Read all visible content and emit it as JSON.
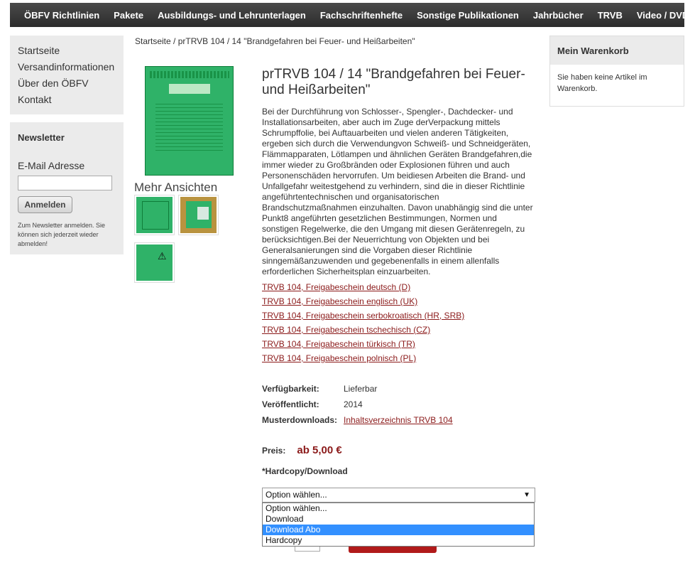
{
  "topnav": [
    "ÖBFV Richtlinien",
    "Pakete",
    "Ausbildungs- und Lehrunterlagen",
    "Fachschriftenhefte",
    "Sonstige Publikationen",
    "Jahrbücher",
    "TRVB",
    "Video / DVD"
  ],
  "sidebar": {
    "items": [
      "Startseite",
      "Versandinformationen",
      "Über den ÖBFV",
      "Kontakt"
    ]
  },
  "newsletter": {
    "title": "Newsletter",
    "email_label": "E-Mail Adresse",
    "button": "Anmelden",
    "note": "Zum Newsletter anmelden. Sie können sich jederzeit wieder abmelden!"
  },
  "breadcrumb": "Startseite / prTRVB 104 / 14 \"Brandgefahren bei Feuer- und Heißarbeiten\"",
  "product": {
    "more_views": "Mehr Ansichten",
    "title": "prTRVB 104 / 14 \"Brandgefahren bei Feuer- und Heißarbeiten\"",
    "description": "Bei der Durchführung von Schlosser-, Spengler-, Dachdecker- und Installationsarbeiten, aber auch im Zuge derVerpackung mittels Schrumpffolie, bei Auftauarbeiten und vielen anderen Tätigkeiten, ergeben sich durch die Verwendungvon Schweiß- und Schneidgeräten, Flämmapparaten, Lötlampen und ähnlichen Geräten Brandgefahren,die immer wieder zu Großbränden oder Explosionen führen und auch Personenschäden hervorrufen. Um beidiesen Arbeiten die Brand- und Unfallgefahr weitestgehend zu verhindern, sind die in dieser Richtlinie angeführtentechnischen und organisatorischen Brandschutzmaßnahmen einzuhalten. Davon unabhängig sind die unter Punkt8 angeführten gesetzlichen Bestimmungen, Normen und sonstigen Regelwerke, die den Umgang mit diesen Gerätenregeln, zu berücksichtigen.Bei der Neuerrichtung von Objekten und bei Generalsanierungen sind die Vorgaben dieser Richtlinie sinngemäßanzuwenden und gegebenenfalls in einem allenfalls erforderlichen Sicherheitsplan einzuarbeiten.",
    "links": [
      "TRVB 104, Freigabeschein deutsch (D)",
      "TRVB 104, Freigabeschein englisch (UK)",
      "TRVB 104, Freigabeschein serbokroatisch (HR, SRB)",
      "TRVB 104, Freigabeschein tschechisch (CZ)",
      "TRVB 104, Freigabeschein türkisch (TR)",
      "TRVB 104, Freigabeschein polnisch (PL)"
    ],
    "attrs": [
      {
        "k": "Verfügbarkeit:",
        "v": "Lieferbar"
      },
      {
        "k": "Veröffentlicht:",
        "v": "2014"
      },
      {
        "k": "Musterdownloads:",
        "v": "Inhaltsverzeichnis TRVB 104"
      }
    ],
    "price_label": "Preis:",
    "price_value": "ab 5,00 €",
    "option_label": "*Hardcopy/Download",
    "select_value": "Option wählen...",
    "options": [
      "Option wählen...",
      "Download",
      "Download Abo",
      "Hardcopy"
    ],
    "highlighted_option": "Download Abo"
  },
  "cart": {
    "title": "Mein Warenkorb",
    "empty": "Sie haben keine Artikel im Warenkorb."
  },
  "colors": {
    "accent": "#8b1a1a",
    "nav": "#333333",
    "highlight": "#3390ff"
  }
}
